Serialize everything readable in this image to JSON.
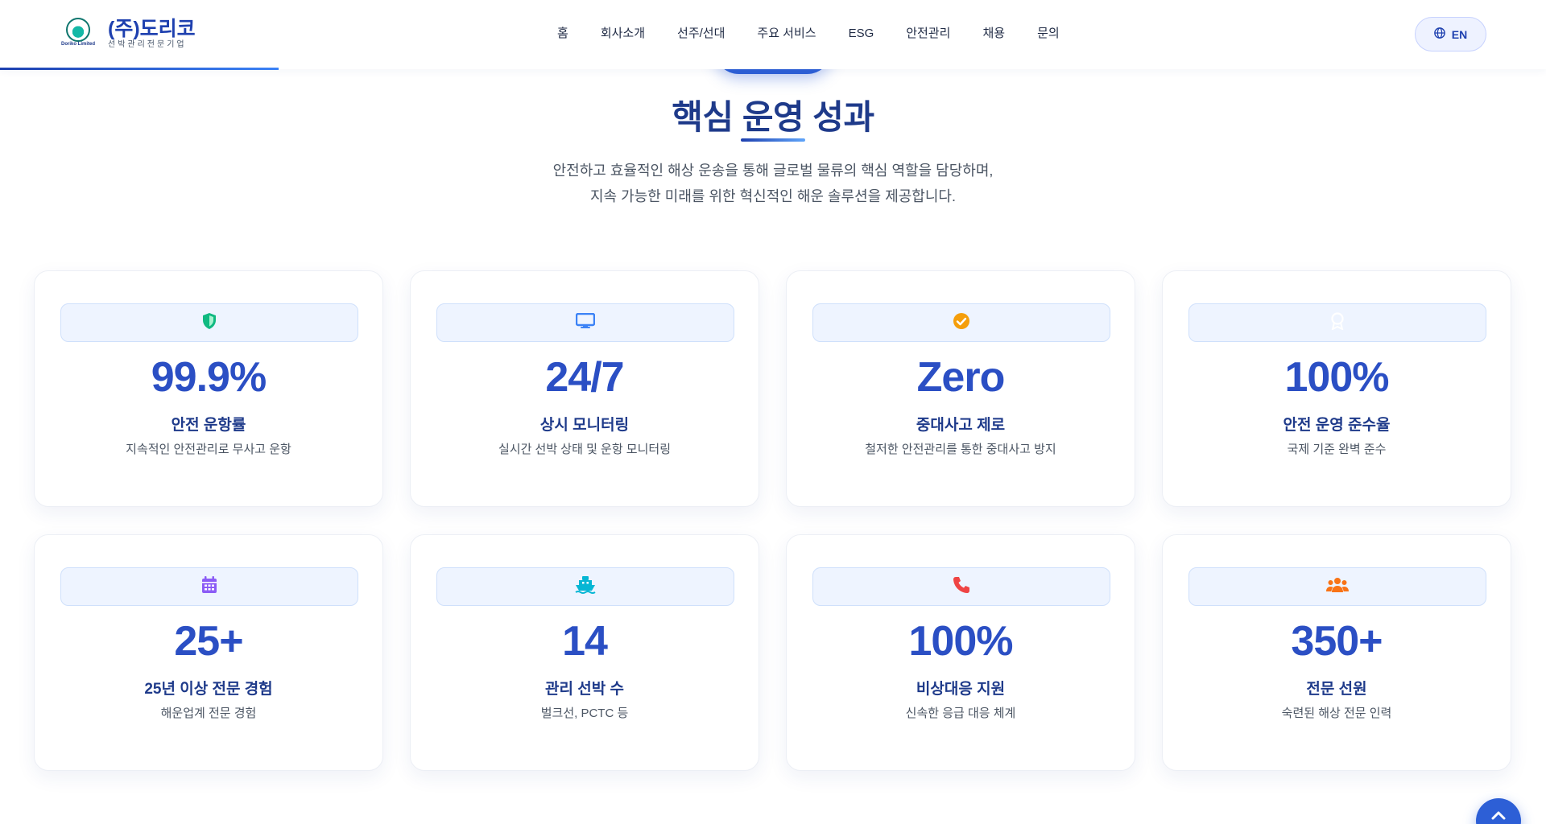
{
  "header": {
    "logo_name": "(주)도리코",
    "logo_tagline": "선박관리전문기업",
    "logo_mark_text": "Doriko Limited",
    "nav": [
      "홈",
      "회사소개",
      "선주/선대",
      "주요 서비스",
      "ESG",
      "안전관리",
      "채용",
      "문의"
    ],
    "lang_label": "EN",
    "progress_fraction": 0.18
  },
  "section": {
    "title": "핵심 운영 성과",
    "desc_line1": "안전하고 효율적인 해상 운송을 통해 글로벌 물류의 핵심 역할을 담당하며,",
    "desc_line2": "지속 가능한 미래를 위한 혁신적인 해운 솔루션을 제공합니다."
  },
  "stats": [
    {
      "icon": "shield-icon",
      "icon_color": "#10b981",
      "value": "99.9%",
      "label": "안전 운항률",
      "sub": "지속적인 안전관리로 무사고 운항"
    },
    {
      "icon": "monitor-icon",
      "icon_color": "#3b82f6",
      "value": "24/7",
      "label": "상시 모니터링",
      "sub": "실시간 선박 상태 및 운항 모니터링"
    },
    {
      "icon": "check-circle-icon",
      "icon_color": "#f59e0b",
      "value": "Zero",
      "label": "중대사고 제로",
      "sub": "철저한 안전관리를 통한 중대사고 방지"
    },
    {
      "icon": "award-icon",
      "icon_color": "#ffffff",
      "value": "100%",
      "label": "안전 운영 준수율",
      "sub": "국제 기준 완벽 준수"
    },
    {
      "icon": "calendar-icon",
      "icon_color": "#8b5cf6",
      "value": "25+",
      "label": "25년 이상 전문 경험",
      "sub": "해운업계 전문 경험"
    },
    {
      "icon": "ship-icon",
      "icon_color": "#06b6d4",
      "value": "14",
      "label": "관리 선박 수",
      "sub": "벌크선, PCTC 등"
    },
    {
      "icon": "phone-icon",
      "icon_color": "#ef4444",
      "value": "100%",
      "label": "비상대응 지원",
      "sub": "신속한 응급 대응 체계"
    },
    {
      "icon": "users-icon",
      "icon_color": "#f97316",
      "value": "350+",
      "label": "전문 선원",
      "sub": "숙련된 해상 전문 인력"
    }
  ]
}
